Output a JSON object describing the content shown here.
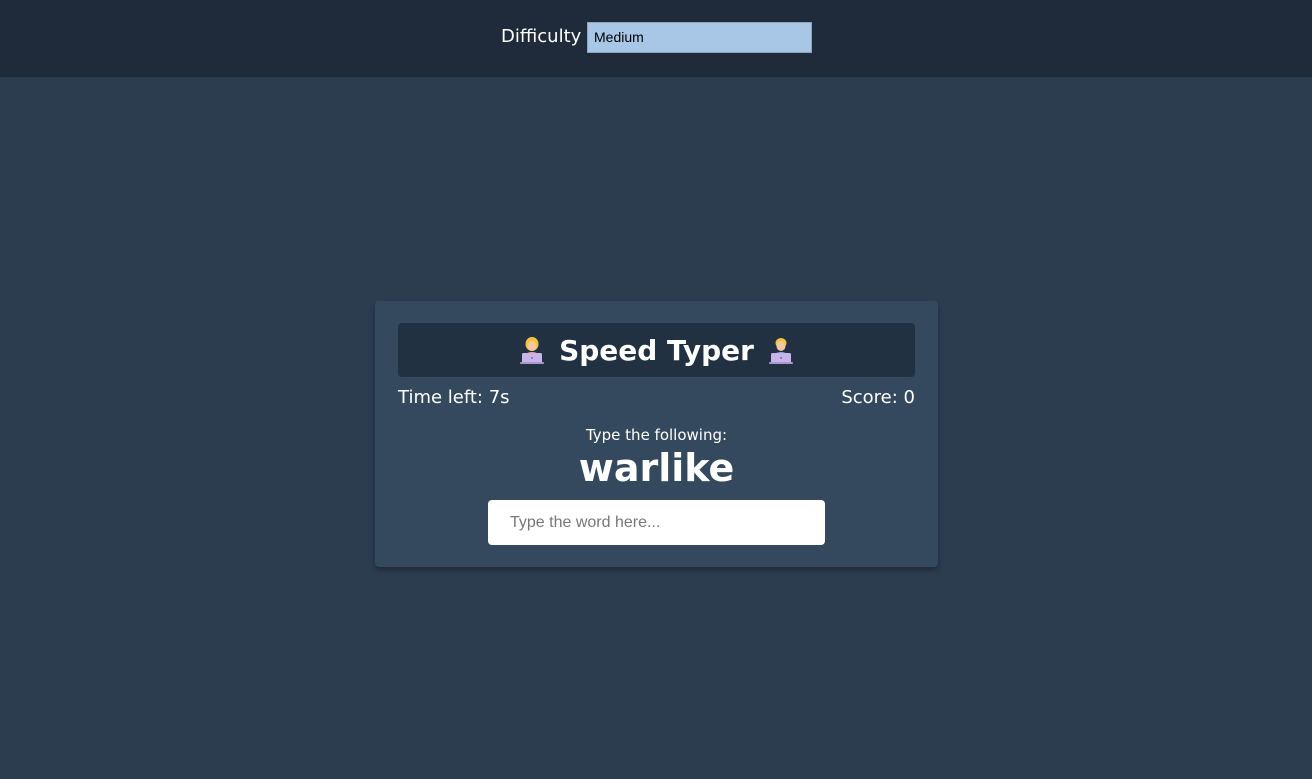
{
  "header": {
    "difficulty_label": "Difficulty",
    "difficulty_selected": "Medium"
  },
  "game": {
    "title": "Speed Typer",
    "left_icon": "person-at-laptop-emoji",
    "right_icon": "person-at-laptop-emoji",
    "time_left_text": "Time left: 7s",
    "score_text": "Score: 0",
    "prompt_label": "Type the following:",
    "current_word": "warlike",
    "input_placeholder": "Type the word here...",
    "input_value": ""
  },
  "colors": {
    "page_background": "#2d3d50",
    "topbar_background": "#1f2a3a",
    "card_background": "#34495e",
    "title_bar_background": "#223142",
    "select_background": "#a8c7e7"
  }
}
